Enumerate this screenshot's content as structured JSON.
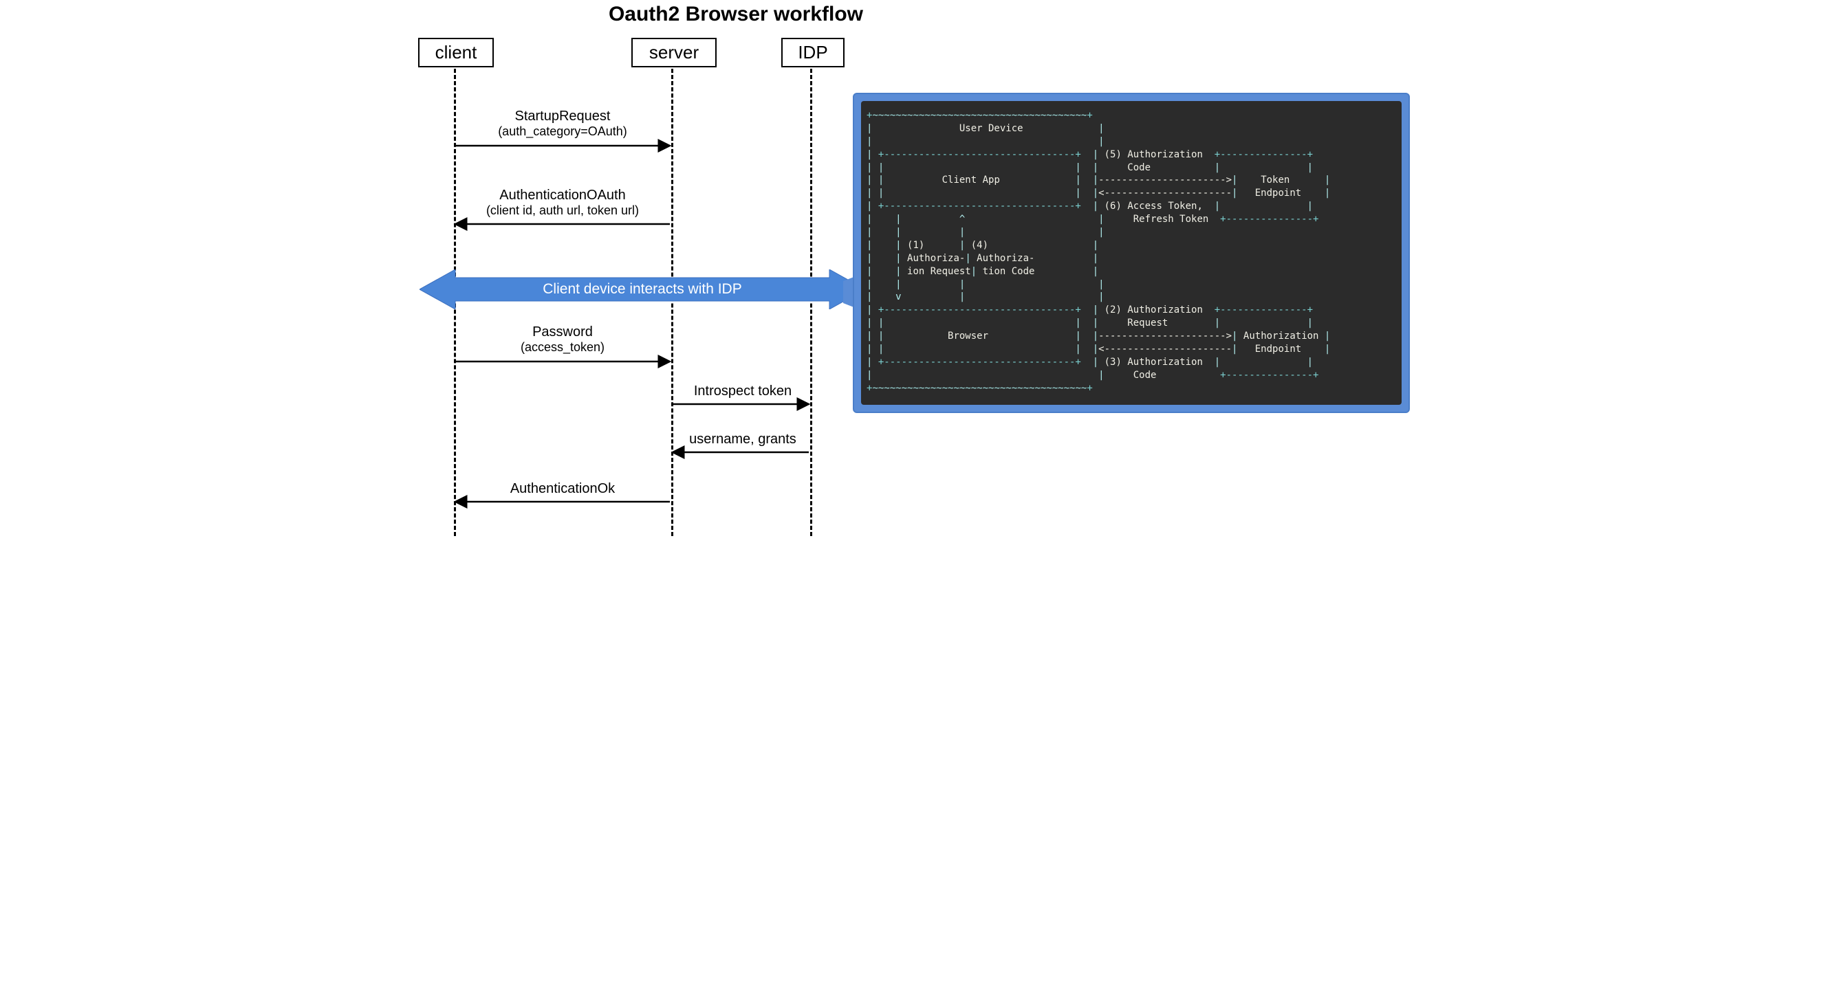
{
  "title": "Oauth2 Browser workflow",
  "participants": {
    "client": "client",
    "server": "server",
    "idp": "IDP"
  },
  "messages": {
    "m1_name": "StartupRequest",
    "m1_detail": "(auth_category=OAuth)",
    "m2_name": "AuthenticationOAuth",
    "m2_detail": "(client id, auth url, token url)",
    "idp_bar": "Client device interacts with IDP",
    "m3_name": "Password",
    "m3_detail": "(access_token)",
    "m4_name": "Introspect token",
    "m5_name": "username, grants",
    "m6_name": "AuthenticationOk"
  },
  "ascii_callout": {
    "lines": [
      "{p}+{w}~~~~~~~~~~~~~~~~~~~~~~~~~~~~~~~~~~~~~{p}+",
      "{b}| {t}              User Device             {b}|",
      "{b}| {b}                                      |",
      "{b}| {p}+---------------------------------+  {b}|{t} (5) Authorization  {p}+---------------+",
      "{b}| {b}|                                 |  |{t}     Code           {b}|               |",
      "{b}| {b}|{t}          Client App            {b} |  |{t}---------------------->{b}|{t}    Token     {b} |",
      "{b}| {b}|                                 |  |{t}<----------------------{b}|{t}   Endpoint   {b} |",
      "{b}| {p}+---------------------------------+  {b}|{t} (6) Access Token,  {b}|               |",
      "{b}| {b}   |          ^                       |{t}     Refresh Token  {p}+---------------+",
      "{b}| {b}   |          |                       |",
      "{b}| {b}   | {t}(1)     {b} | {t}(4)                  {b}|",
      "{b}| {b}   | {t}Authoriza-{b}| {t}Authoriza-          {b}|",
      "{b}| {b}   | {t}ion Request{b}| {t}tion Code          {b}|",
      "{b}| {b}   |          |                       |",
      "{b}| {b}   v          |                       |",
      "{b}| {p}+---------------------------------+  {b}|{t} (2) Authorization  {p}+---------------+",
      "{b}| {b}|                                 |  |{t}     Request        {b}|               |",
      "{b}| {b}|{t}           Browser             {b}  |  |{t}---------------------->{b}|{t} Authorization {b}|",
      "{b}| {b}|                                 |  |{t}<----------------------{b}|{t}   Endpoint   {b} |",
      "{b}| {p}+---------------------------------+  {b}|{t} (3) Authorization  {b}|               |",
      "{b}| {b}                                      |{t}     Code           {p}+---------------+",
      "{p}+{w}~~~~~~~~~~~~~~~~~~~~~~~~~~~~~~~~~~~~~{p}+"
    ]
  }
}
